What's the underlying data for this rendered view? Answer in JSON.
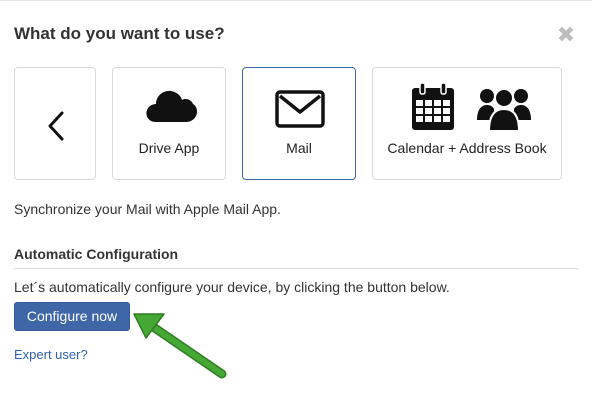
{
  "dialog": {
    "title": "What do you want to use?",
    "close_icon": "close-icon"
  },
  "options": [
    {
      "label": "",
      "icon": "chevron-left-icon"
    },
    {
      "label": "Drive App",
      "icon": "cloud-icon"
    },
    {
      "label": "Mail",
      "icon": "envelope-icon",
      "selected": true
    },
    {
      "label": "Calendar + Address Book",
      "icon": "calendar-icon, people-icon"
    }
  ],
  "description": "Synchronize your Mail with Apple Mail App.",
  "automatic": {
    "title": "Automatic Configuration",
    "hint": "Let´s automatically configure your device, by clicking the button below.",
    "button_label": "Configure now"
  },
  "expert_link": "Expert user?",
  "colors": {
    "accent": "#3f66a7",
    "link": "#2f63b0",
    "annotation_arrow": "#3c9b2e"
  }
}
